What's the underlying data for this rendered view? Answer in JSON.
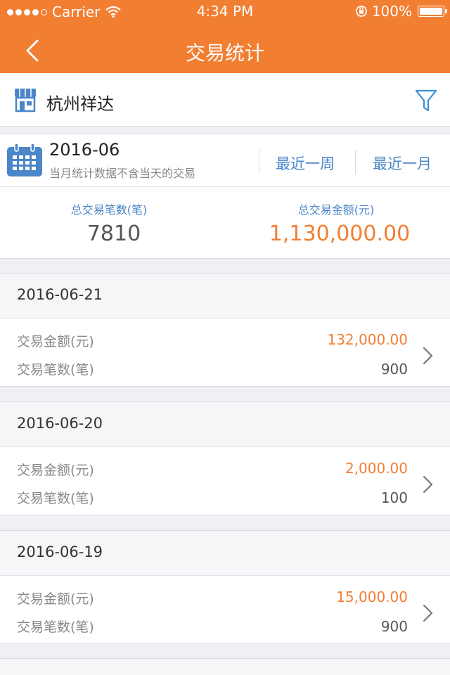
{
  "status_bar": {
    "carrier": "Carrier",
    "time": "4:34 PM",
    "battery": "100%"
  },
  "nav": {
    "title": "交易统计",
    "back_icon": "chevron-left-icon"
  },
  "store": {
    "name": "杭州祥达",
    "icon": "store-icon",
    "filter_icon": "filter-icon"
  },
  "summary": {
    "month": "2016-06",
    "note": "当月统计数据不含当天的交易",
    "range_week": "最近一周",
    "range_month": "最近一月",
    "count_label": "总交易笔数(笔)",
    "count_value": "7810",
    "amount_label": "总交易金额(元)",
    "amount_value": "1,130,000.00"
  },
  "records": [
    {
      "date": "2016-06-21",
      "amount_label": "交易金额(元)",
      "amount": "132,000.00",
      "count_label": "交易笔数(笔)",
      "count": "900"
    },
    {
      "date": "2016-06-20",
      "amount_label": "交易金额(元)",
      "amount": "2,000.00",
      "count_label": "交易笔数(笔)",
      "count": "100"
    },
    {
      "date": "2016-06-19",
      "amount_label": "交易金额(元)",
      "amount": "15,000.00",
      "count_label": "交易笔数(笔)",
      "count": "900"
    }
  ],
  "colors": {
    "accent": "#f27e32",
    "link": "#4a86c8"
  }
}
